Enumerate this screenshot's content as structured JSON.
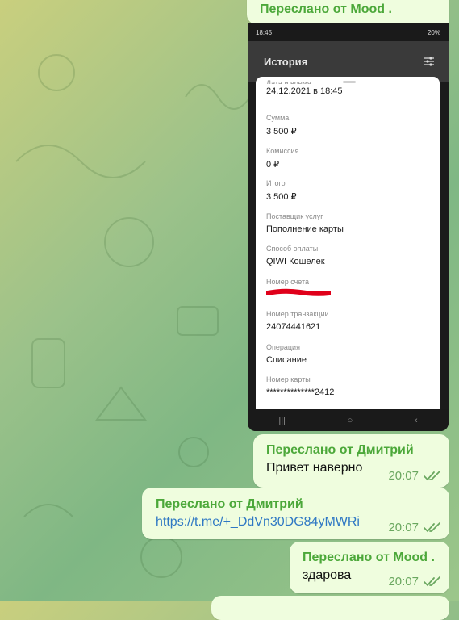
{
  "messages": [
    {
      "forwarded_from": "Переслано от Mood ."
    },
    {
      "forwarded_from": "Переслано от Дмитрий",
      "text": "Привет наверно",
      "time": "20:07"
    },
    {
      "forwarded_from": "Переслано от Дмитрий",
      "link": "https://t.me/+_DdVn30DG84yMWRi",
      "time": "20:07"
    },
    {
      "forwarded_from": "Переслано от Mood .",
      "text": "здарова",
      "time": "20:07"
    }
  ],
  "phone": {
    "status_time": "18:45",
    "battery": "20%",
    "header_title": "История",
    "fields": [
      {
        "label": "Дата и время",
        "value": "24.12.2021 в 18:45"
      },
      {
        "label": "Сумма",
        "value": "3 500 ₽"
      },
      {
        "label": "Комиссия",
        "value": "0 ₽"
      },
      {
        "label": "Итого",
        "value": "3 500 ₽"
      },
      {
        "label": "Поставщик услуг",
        "value": "Пополнение карты"
      },
      {
        "label": "Способ оплаты",
        "value": "QIWI Кошелек"
      },
      {
        "label": "Номер счета",
        "value": ""
      },
      {
        "label": "Номер транзакции",
        "value": "24074441621"
      },
      {
        "label": "Операция",
        "value": "Списание"
      },
      {
        "label": "Номер карты",
        "value": "**************2412"
      }
    ]
  },
  "colors": {
    "bubble": "#effdde",
    "forward_name": "#4ca83a",
    "link": "#2f78c4",
    "check": "#6aa75f",
    "redaction": "#e0001a"
  },
  "icons": [
    "read-check-icon",
    "filter-icon",
    "back-icon",
    "home-icon",
    "recents-icon"
  ]
}
